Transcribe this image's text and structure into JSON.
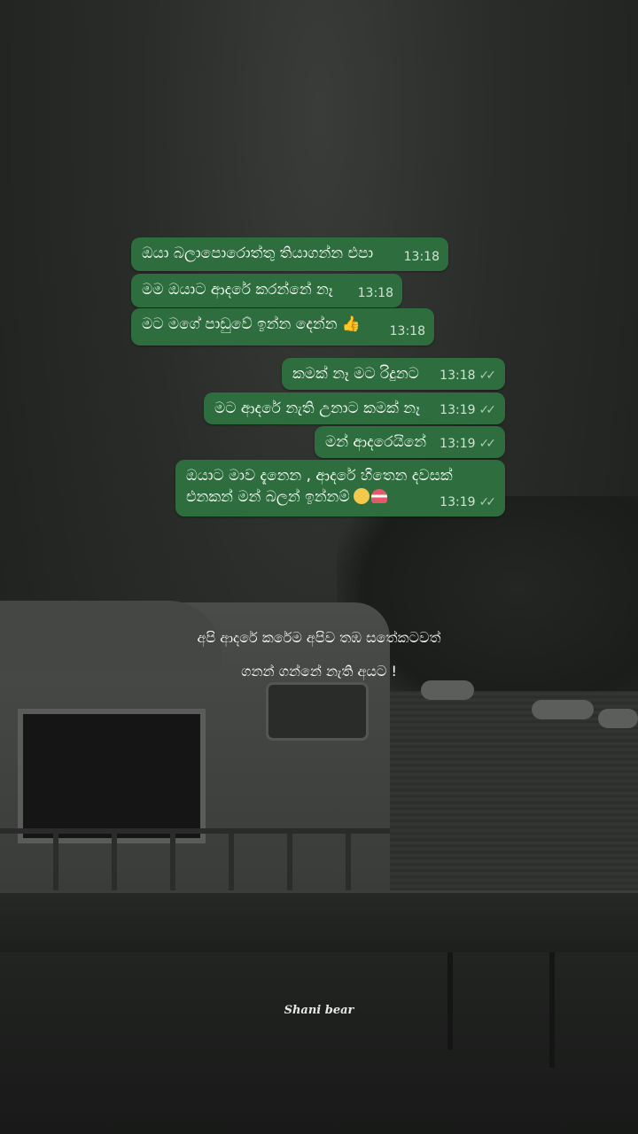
{
  "messages": [
    {
      "side": "in",
      "text": "ඔයා බලාපොරොත්තු තියාගන්න එපා",
      "time": "13:18"
    },
    {
      "side": "in",
      "text": "මම ඔයාට ආදරේ කරන්නේ නෑ",
      "time": "13:18"
    },
    {
      "side": "in",
      "text": "මට මගේ පාඩුවේ ඉන්න දෙන්න 👍",
      "time": "13:18"
    },
    {
      "side": "out",
      "text": "කමක් නෑ මට රිදුනට",
      "time": "13:18"
    },
    {
      "side": "out",
      "text": "මට ආදරේ නැති උනාට කමක් නෑ",
      "time": "13:19"
    },
    {
      "side": "out",
      "text": "මන් ආදරෙයිනේ",
      "time": "13:19"
    },
    {
      "side": "out",
      "text": "ඔයාට මාව දැනෙන , ආදරේ හිතෙන දවසක්\nඑනකන් මන් බලන් ඉන්නම්",
      "time": "13:19"
    }
  ],
  "read_ticks": "✓✓",
  "quote": {
    "line1": "අපි ආදරේ කරේම අපිව තඹ සතේකටවත්",
    "line2": "ගනන් ගන්නේ නැති අයට  !"
  },
  "signature": "Shani bear",
  "colors": {
    "bubble": "#2e6e3e",
    "background": "#1f211f"
  },
  "icons": [
    "thumbs-up-icon",
    "pleading-face-icon",
    "heart-icon",
    "double-check-icon"
  ]
}
